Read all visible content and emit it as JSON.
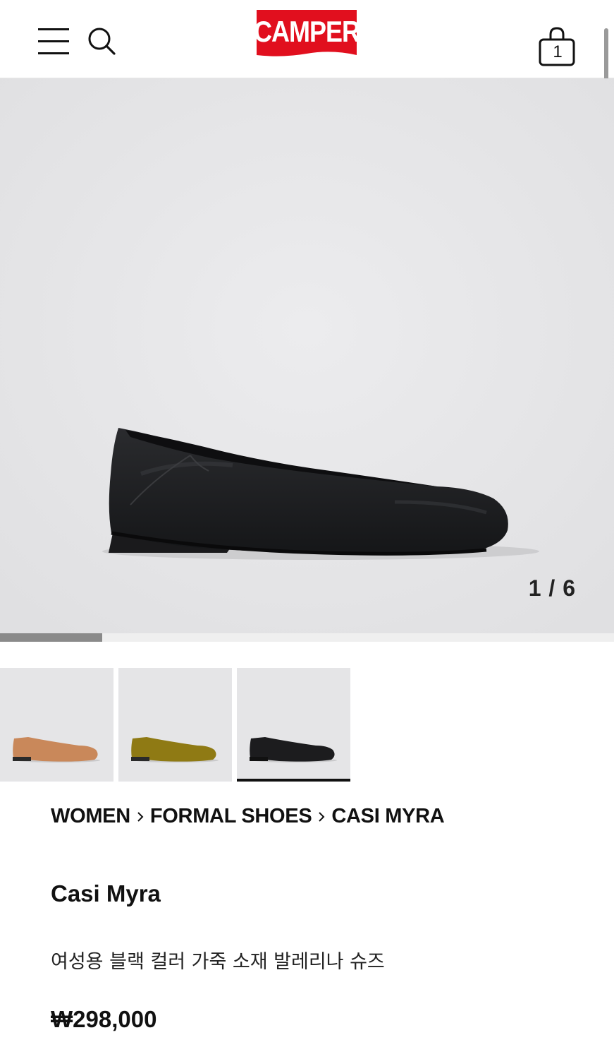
{
  "header": {
    "brand": "CAMPER",
    "cart_count": "1",
    "colors": {
      "brand_red": "#e10f1e",
      "brand_text": "#ffffff"
    },
    "icons": [
      "menu-icon",
      "search-icon",
      "shopping-bag-icon"
    ]
  },
  "gallery": {
    "counter": "1 / 6",
    "progress": 0.167,
    "main_image": "black leather ballerina shoe, side view"
  },
  "colors": [
    {
      "name": "tan",
      "swatch": "#c9885a",
      "active": false
    },
    {
      "name": "olive",
      "swatch": "#8f7a14",
      "active": false
    },
    {
      "name": "black",
      "swatch": "#1c1c1e",
      "active": true
    }
  ],
  "breadcrumb": [
    "WOMEN",
    "FORMAL SHOES",
    "CASI MYRA"
  ],
  "product": {
    "name": "Casi Myra",
    "description": "여성용 블랙 컬러 가죽 소재 발레리나 슈즈",
    "price": "₩298,000"
  }
}
